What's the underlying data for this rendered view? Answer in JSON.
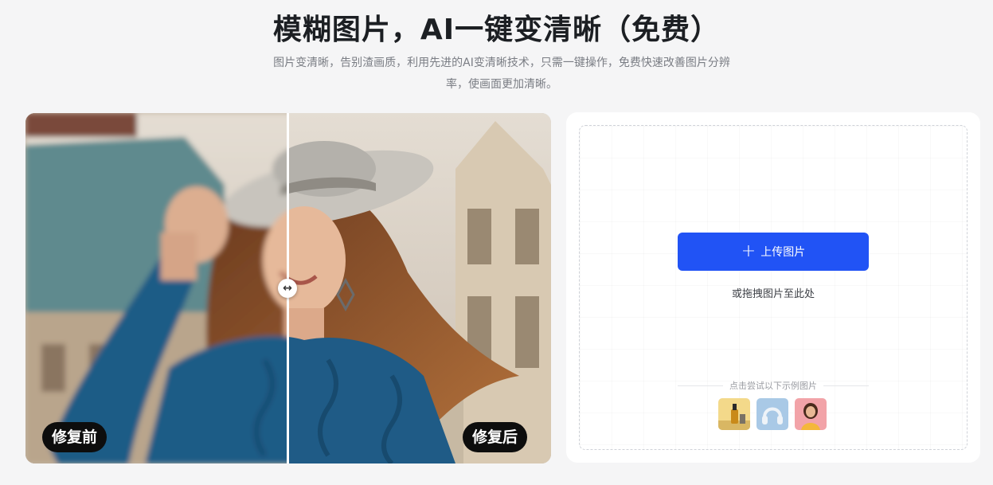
{
  "header": {
    "title": "模糊图片，AI一键变清晰（免费）",
    "subtitle": "图片变清晰，告别渣画质，利用先进的AI变清晰技术，只需一键操作，免费快速改善图片分辨率，使画面更加清晰。"
  },
  "compare": {
    "before_label": "修复前",
    "after_label": "修复后",
    "slider_icon": "left-right-arrows-icon"
  },
  "upload": {
    "button_icon": "plus-icon",
    "button_label": "上传图片",
    "drag_hint": "或拖拽图片至此处",
    "samples_label": "点击尝试以下示例图片",
    "samples": [
      {
        "icon": "serum-bottle-thumb"
      },
      {
        "icon": "headphones-thumb"
      },
      {
        "icon": "woman-portrait-thumb"
      }
    ],
    "accent_color": "#2153f5"
  }
}
